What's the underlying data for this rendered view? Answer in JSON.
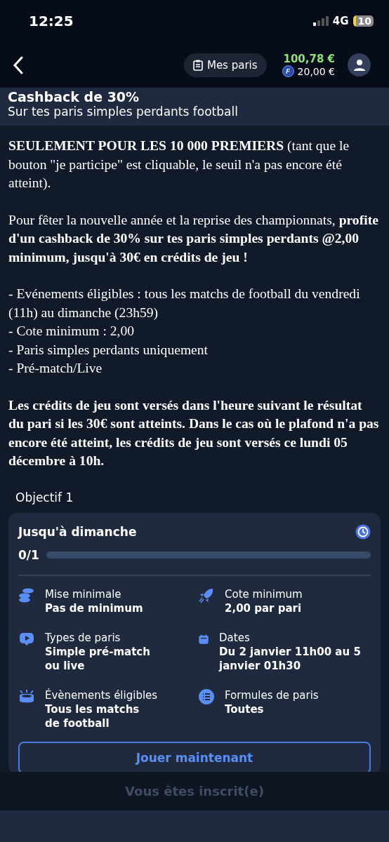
{
  "status_bar": {
    "time": "12:25",
    "network": "4G",
    "battery": "10"
  },
  "header": {
    "my_bets": "Mes paris",
    "balance": "100,78 €",
    "freebet": "20,00 €",
    "freebet_badge": "F"
  },
  "promo": {
    "title": "Cashback de 30%",
    "subtitle": "Sur tes paris simples perdants football"
  },
  "description": [
    {
      "kind": "text",
      "text": "**SEULEMENT POUR LES 10 000 PREMIERS** (tant que le bouton \"je participe\" est cliquable, le seuil n'a pas encore été atteint)."
    },
    {
      "kind": "text",
      "text": "Pour fêter la nouvelle année et la reprise des championnats, **profite d'un cashback de 30% sur tes paris simples perdants @2,00 minimum, jusqu'à 30€ en crédits de jeu !**"
    },
    {
      "kind": "lines",
      "lines": [
        "- Evénements éligibles : tous les matchs de football du vendredi (11h) au dimanche (23h59)",
        "- Cote minimum : 2,00",
        "- Paris simples perdants uniquement",
        "- Pré-match/Live"
      ]
    },
    {
      "kind": "bold",
      "text": "Les crédits de jeu sont versés dans l'heure suivant le résultat du pari si les 30€ sont atteints. Dans le cas où le plafond n'a pas encore été atteint, les crédits de jeu sont versés ce lundi 05 décembre à 10h."
    }
  ],
  "objective": {
    "label": "Objectif 1",
    "title": "Jusqu'à dimanche",
    "progress_text": "0/1",
    "level": 0,
    "details": [
      {
        "kind": "coins",
        "label": "Mise minimale",
        "value": "Pas de minimum"
      },
      {
        "kind": "rocket",
        "label": "Cote minimum",
        "value": "2,00 par pari"
      },
      {
        "kind": "play",
        "label": "Types de paris",
        "value": "Simple pré-match\nou live"
      },
      {
        "kind": "calendar",
        "label": "Dates",
        "value": "Du 2 janvier 11h00 au 5 janvier 01h30"
      },
      {
        "kind": "stadium",
        "label": "Évènements éligibles",
        "value": "Tous les matchs\nde football"
      },
      {
        "kind": "list",
        "label": "Formules de paris",
        "value": "Toutes"
      }
    ],
    "play_button": "Jouer maintenant"
  },
  "footer": {
    "button": "Vous êtes inscrit(e)",
    "disabled": true
  }
}
